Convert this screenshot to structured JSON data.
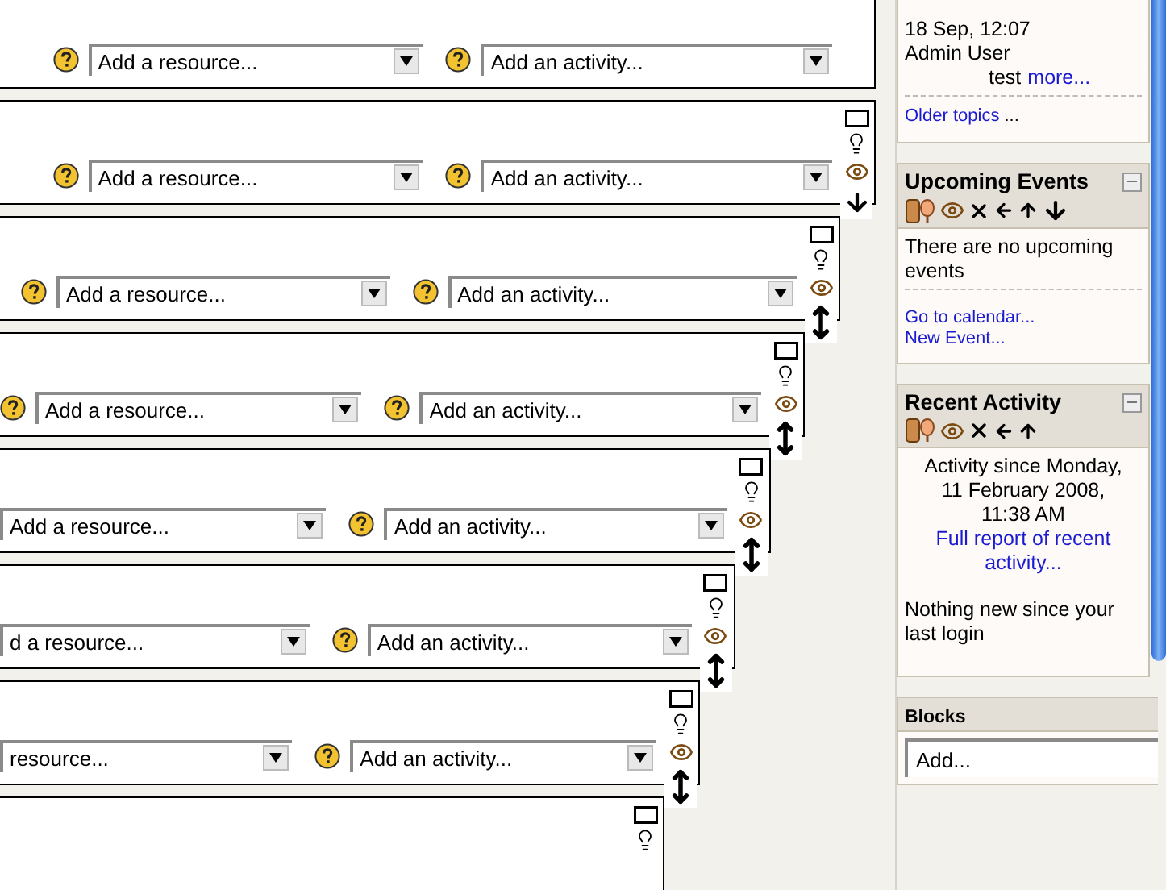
{
  "sections": [
    {
      "resource_select": "Add a resource...",
      "resource_help": true,
      "activity_select": "Add an activity..."
    },
    {
      "resource_select": "Add a resource...",
      "resource_help": true,
      "activity_select": "Add an activity...",
      "controls": [
        {
          "kind": "box"
        },
        {
          "kind": "bulb"
        },
        {
          "kind": "eye"
        },
        {
          "kind": "down"
        }
      ]
    },
    {
      "resource_select": "Add a resource...",
      "resource_help": true,
      "activity_select": "Add an activity...",
      "controls": [
        {
          "kind": "box"
        },
        {
          "kind": "bulb"
        },
        {
          "kind": "eye"
        },
        {
          "kind": "updown"
        }
      ]
    },
    {
      "resource_select": "Add a resource...",
      "resource_help": true,
      "activity_select": "Add an activity...",
      "controls": [
        {
          "kind": "box"
        },
        {
          "kind": "bulb"
        },
        {
          "kind": "eye"
        },
        {
          "kind": "updown"
        }
      ]
    },
    {
      "resource_select": "Add a resource...",
      "resource_help": false,
      "activity_select": "Add an activity...",
      "controls": [
        {
          "kind": "box"
        },
        {
          "kind": "bulb"
        },
        {
          "kind": "eye"
        },
        {
          "kind": "updown"
        }
      ]
    },
    {
      "resource_select": "d a resource...",
      "resource_help": false,
      "activity_select": "Add an activity...",
      "controls": [
        {
          "kind": "box"
        },
        {
          "kind": "bulb"
        },
        {
          "kind": "eye"
        },
        {
          "kind": "updown"
        }
      ]
    },
    {
      "resource_select": "resource...",
      "resource_help": false,
      "activity_select": "Add an activity...",
      "controls": [
        {
          "kind": "box"
        },
        {
          "kind": "bulb"
        },
        {
          "kind": "eye"
        },
        {
          "kind": "updown"
        }
      ]
    },
    {
      "controls": [
        {
          "kind": "box"
        },
        {
          "kind": "bulb"
        }
      ]
    }
  ],
  "sidebar": {
    "news": {
      "lines": [
        "18 Sep, 12:07",
        "Admin User"
      ],
      "post": "test",
      "more_link": "more...",
      "older_link": "Older topics",
      "older_suffix": "..."
    },
    "upcoming": {
      "title": "Upcoming Events",
      "controls": [
        {
          "kind": "roles"
        },
        {
          "kind": "eye"
        },
        {
          "kind": "delete"
        },
        {
          "kind": "left"
        },
        {
          "kind": "up"
        },
        {
          "kind": "down"
        }
      ],
      "message": "There are no upcoming events",
      "links": [
        "Go to calendar...",
        "New Event..."
      ]
    },
    "recent": {
      "title": "Recent Activity",
      "controls": [
        {
          "kind": "roles"
        },
        {
          "kind": "eye"
        },
        {
          "kind": "delete"
        },
        {
          "kind": "left"
        },
        {
          "kind": "up"
        }
      ],
      "since": [
        "Activity since Monday,",
        "11 February 2008,",
        "11:38 AM"
      ],
      "report_link": "Full report of recent activity...",
      "note": "Nothing new since your last login"
    },
    "blocks": {
      "title": "Blocks",
      "select": "Add..."
    }
  }
}
